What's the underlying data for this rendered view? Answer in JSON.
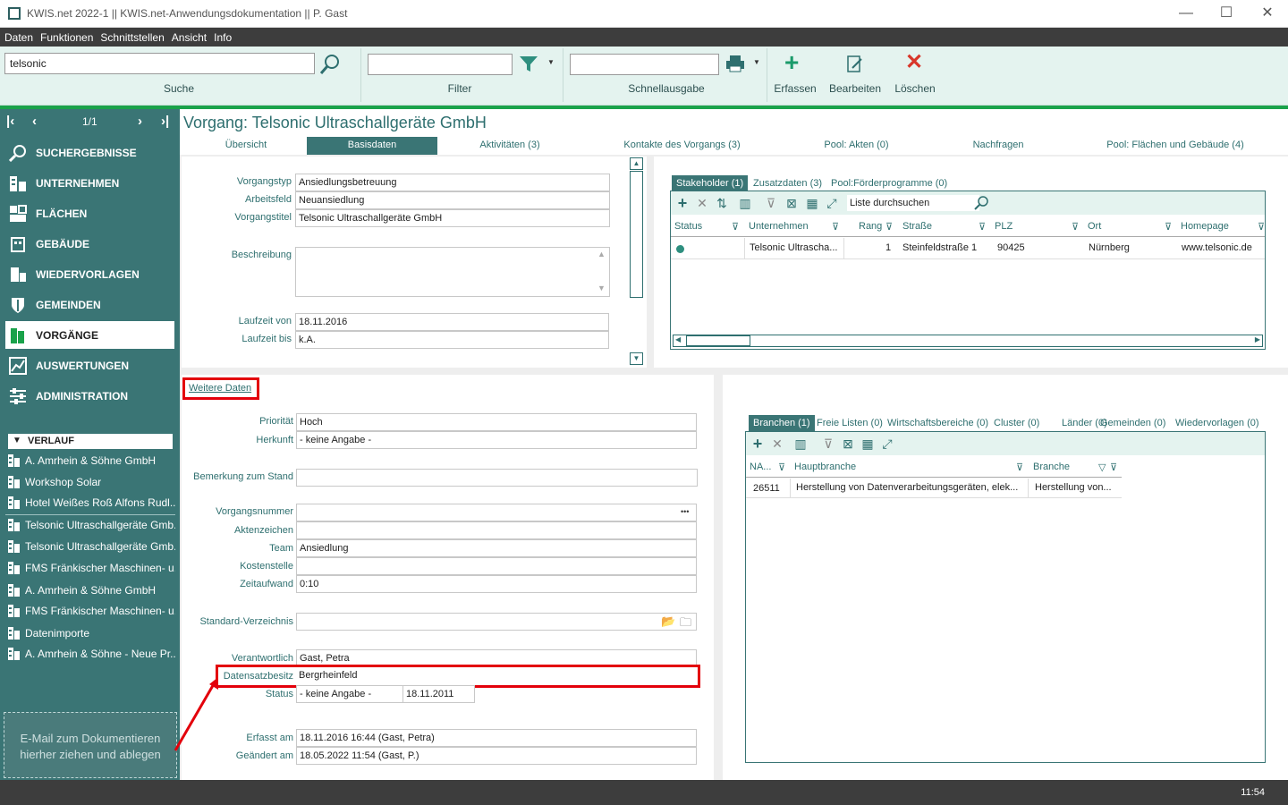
{
  "window": {
    "title": "KWIS.net 2022-1 || KWIS.net-Anwendungsdokumentation || P. Gast",
    "minimize": "—",
    "maximize": "☐",
    "close": "✕"
  },
  "menu": [
    "Daten",
    "Funktionen",
    "Schnittstellen",
    "Ansicht",
    "Info"
  ],
  "ribbon": {
    "search_value": "telsonic",
    "search_label": "Suche",
    "filter_value": "",
    "filter_label": "Filter",
    "quick_value": "",
    "quick_label": "Schnellausgabe",
    "create_label": "Erfassen",
    "edit_label": "Bearbeiten",
    "delete_label": "Löschen"
  },
  "pager": {
    "text": "1/1"
  },
  "nav": [
    {
      "label": "SUCHERGEBNISSE",
      "icon": "magnifier-icon"
    },
    {
      "label": "UNTERNEHMEN",
      "icon": "company-icon"
    },
    {
      "label": "FLÄCHEN",
      "icon": "area-icon"
    },
    {
      "label": "GEBÄUDE",
      "icon": "building-icon"
    },
    {
      "label": "WIEDERVORLAGEN",
      "icon": "reminder-icon"
    },
    {
      "label": "GEMEINDEN",
      "icon": "shield-icon"
    },
    {
      "label": "VORGÄNGE",
      "icon": "folder-icon"
    },
    {
      "label": "AUSWERTUNGEN",
      "icon": "chart-icon"
    },
    {
      "label": "ADMINISTRATION",
      "icon": "sliders-icon"
    }
  ],
  "history": {
    "title": "VERLAUF",
    "items": [
      "A. Amrhein & Söhne GmbH",
      "Workshop Solar",
      "Hotel Weißes Roß Alfons Rudl...",
      "Telsonic Ultraschallgeräte Gmb...",
      "Telsonic Ultraschallgeräte Gmb...",
      "FMS Fränkischer Maschinen- u...",
      "A. Amrhein & Söhne GmbH",
      "FMS Fränkischer Maschinen- u...",
      "Datenimporte",
      "A. Amrhein & Söhne - Neue Pr..."
    ]
  },
  "dropzone": {
    "line1": "E-Mail  zum Dokumentieren",
    "line2": "hierher ziehen und ablegen"
  },
  "header": {
    "title": "Vorgang: Telsonic Ultraschallgeräte GmbH"
  },
  "tabs": [
    "Übersicht",
    "Basisdaten",
    "Aktivitäten (3)",
    "Kontakte des Vorgangs (3)",
    "Pool: Akten (0)",
    "Nachfragen",
    "Pool: Flächen und Gebäude (4)"
  ],
  "basis": {
    "vorgangstyp_label": "Vorgangstyp",
    "vorgangstyp": "Ansiedlungsbetreuung",
    "arbeitsfeld_label": "Arbeitsfeld",
    "arbeitsfeld": "Neuansiedlung",
    "vorgangstitel_label": "Vorgangstitel",
    "vorgangstitel": "Telsonic Ultraschallgeräte GmbH",
    "beschreibung_label": "Beschreibung",
    "beschreibung": "",
    "laufzeit_von_label": "Laufzeit von",
    "laufzeit_von": "18.11.2016",
    "laufzeit_bis_label": "Laufzeit bis",
    "laufzeit_bis": "k.A."
  },
  "stakeholder": {
    "tabs": [
      "Stakeholder (1)",
      "Zusatzdaten (3)",
      "Pool:Förderprogramme (0)"
    ],
    "search_placeholder": "Liste durchsuchen",
    "columns": [
      "Status",
      "Unternehmen",
      "Rang",
      "Straße",
      "PLZ",
      "Ort",
      "Homepage"
    ],
    "rows": [
      {
        "unternehmen": "Telsonic Ultrascha...",
        "rang": "1",
        "strasse": "Steinfeldstraße 1",
        "plz": "90425",
        "ort": "Nürnberg",
        "homepage": "www.telsonic.de"
      }
    ]
  },
  "weitere": {
    "link": "Weitere Daten",
    "prioritaet_label": "Priorität",
    "prioritaet": "Hoch",
    "herkunft_label": "Herkunft",
    "herkunft": "- keine Angabe -",
    "bemerkung_label": "Bemerkung zum Stand",
    "bemerkung": "",
    "vorgangsnummer_label": "Vorgangsnummer",
    "vorgangsnummer": "",
    "aktenzeichen_label": "Aktenzeichen",
    "aktenzeichen": "",
    "team_label": "Team",
    "team": "Ansiedlung",
    "kostenstelle_label": "Kostenstelle",
    "kostenstelle": "",
    "zeitaufwand_label": "Zeitaufwand",
    "zeitaufwand": "0:10",
    "verzeichnis_label": "Standard-Verzeichnis",
    "verzeichnis": "",
    "verantwortlich_label": "Verantwortlich",
    "verantwortlich": "Gast, Petra",
    "datensatzbesitz_label": "Datensatzbesitz",
    "datensatzbesitz": "Bergrheinfeld",
    "status_label": "Status",
    "status": "- keine Angabe -",
    "status_date": "18.11.2011",
    "erfasst_label": "Erfasst am",
    "erfasst": "18.11.2016 16:44 (Gast, Petra)",
    "geaendert_label": "Geändert am",
    "geaendert": "18.05.2022 11:54 (Gast, P.)",
    "ellipsis": "•••"
  },
  "branchen": {
    "tabs": [
      "Branchen (1)",
      "Freie Listen (0)",
      "Wirtschaftsbereiche (0)",
      "Cluster (0)",
      "Länder (0)",
      "Gemeinden (0)",
      "Wiedervorlagen (0)"
    ],
    "columns": [
      "NA...",
      "Hauptbranche",
      "Branche"
    ],
    "rows": [
      {
        "na": "26511",
        "haupt": "Herstellung von Datenverarbeitungsgeräten, elek...",
        "branche": "Herstellung von..."
      }
    ]
  },
  "statusbar": {
    "time": "11:54"
  },
  "colors": {
    "teal": "#3a7575",
    "ribbon": "#e4f3ef",
    "accent_green": "#1aa24a",
    "highlight_red": "#e3000b"
  }
}
